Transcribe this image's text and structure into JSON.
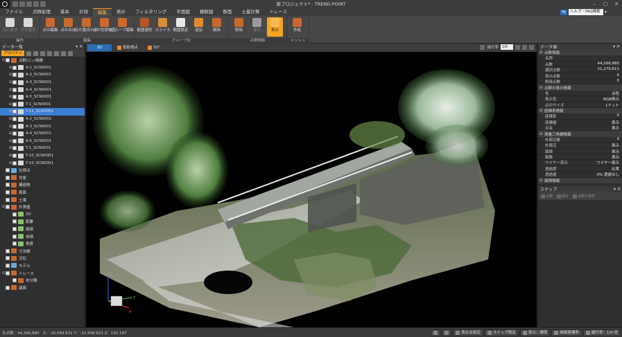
{
  "window": {
    "title": "新プロジェクト* - TREND-POINT",
    "controls": [
      "–",
      "▢",
      "✕"
    ]
  },
  "menu": {
    "tabs": [
      {
        "label": "ファイル",
        "active": false
      },
      {
        "label": "点群処理",
        "active": false
      },
      {
        "label": "基本",
        "active": false
      },
      {
        "label": "計測",
        "active": false
      },
      {
        "label": "編集",
        "active": true
      },
      {
        "label": "表示",
        "active": false
      },
      {
        "label": "フィルタリング",
        "active": false
      },
      {
        "label": "平面図",
        "active": false
      },
      {
        "label": "横断図",
        "active": false
      },
      {
        "label": "断面",
        "active": false
      },
      {
        "label": "土量計算",
        "active": false
      },
      {
        "label": "トレース",
        "active": false
      }
    ],
    "help_badge": "FA",
    "help_label": "ヘルプ・FAQ検索"
  },
  "ribbon": {
    "groups": [
      {
        "title": "操作",
        "buttons": [
          {
            "label": "元に戻す",
            "color": "#d9d9d9",
            "dim": true
          },
          {
            "label": "やり直す",
            "color": "#d9d9d9",
            "dim": true
          }
        ]
      },
      {
        "title": "編集",
        "buttons": [
          {
            "label": "点の編集",
            "color": "#c9692f"
          },
          {
            "label": "点の合成",
            "color": "#c9692f"
          },
          {
            "label": "点の重合わせ",
            "color": "#c9692f"
          },
          {
            "label": "点の色調補正",
            "color": "#c9692f"
          },
          {
            "label": "グループ編集",
            "color": "#c9692f"
          }
        ]
      },
      {
        "title": "グループ化",
        "buttons": [
          {
            "label": "範囲選択",
            "color": "#b8542a"
          },
          {
            "label": "スライス",
            "color": "#d98c3a"
          },
          {
            "label": "範囲設定",
            "color": "#e8e8e8"
          },
          {
            "label": "追加",
            "color": "#e38b2c"
          },
          {
            "label": "解除",
            "color": "#c9692f"
          }
        ]
      },
      {
        "title": "点群削除",
        "buttons": [
          {
            "label": "削除",
            "color": "#c9692f"
          },
          {
            "label": "復元",
            "color": "#999999",
            "dim": true
          },
          {
            "label": "表示",
            "color": "#f7b955",
            "active": true
          }
        ]
      },
      {
        "title": "メッシュ",
        "buttons": [
          {
            "label": "作成",
            "color": "#c9692f"
          }
        ]
      }
    ]
  },
  "tree_panel": {
    "title": "データ一覧",
    "property_tab": "プロパティ",
    "items": [
      {
        "label": "点群/二ッ梅橋",
        "indent": 0,
        "expander": "⊟",
        "icon_color": "#c9692f",
        "checked": true,
        "selected": false
      },
      {
        "label": "A-1_SCN0001",
        "indent": 1,
        "expander": "⊞",
        "icon_color": "#d8d8d8",
        "checked": true,
        "selected": false
      },
      {
        "label": "A-2_SCN0001",
        "indent": 1,
        "expander": "⊞",
        "icon_color": "#d8d8d8",
        "checked": true,
        "selected": false
      },
      {
        "label": "A-3_SCN0001",
        "indent": 1,
        "expander": "⊞",
        "icon_color": "#d8d8d8",
        "checked": true,
        "selected": false
      },
      {
        "label": "A-4_SCN0001",
        "indent": 1,
        "expander": "⊞",
        "icon_color": "#d8d8d8",
        "checked": true,
        "selected": false
      },
      {
        "label": "A-5_SCN0001",
        "indent": 1,
        "expander": "⊞",
        "icon_color": "#d8d8d8",
        "checked": true,
        "selected": false
      },
      {
        "label": "T-1_SCN0001",
        "indent": 1,
        "expander": "⊞",
        "icon_color": "#d8d8d8",
        "checked": true,
        "selected": false
      },
      {
        "label": "T-11_SCN0001",
        "indent": 1,
        "expander": "⊞",
        "icon_color": "#d8d8d8",
        "checked": true,
        "selected": true
      },
      {
        "label": "A-2_SCN0001",
        "indent": 1,
        "expander": "⊞",
        "icon_color": "#d8d8d8",
        "checked": true,
        "selected": false
      },
      {
        "label": "A-3_SCN0001",
        "indent": 1,
        "expander": "⊞",
        "icon_color": "#d8d8d8",
        "checked": true,
        "selected": false
      },
      {
        "label": "A-4_SCN0001",
        "indent": 1,
        "expander": "⊞",
        "icon_color": "#d8d8d8",
        "checked": true,
        "selected": false
      },
      {
        "label": "A-5_SCN0001",
        "indent": 1,
        "expander": "⊞",
        "icon_color": "#d8d8d8",
        "checked": true,
        "selected": false
      },
      {
        "label": "T-1_SCN0001",
        "indent": 1,
        "expander": "⊞",
        "icon_color": "#d8d8d8",
        "checked": true,
        "selected": false
      },
      {
        "label": "T-10_SCN0001",
        "indent": 1,
        "expander": "⊞",
        "icon_color": "#d8d8d8",
        "checked": true,
        "selected": false
      },
      {
        "label": "T-10_SCN0001",
        "indent": 1,
        "expander": "⊞",
        "icon_color": "#d8d8d8",
        "checked": true,
        "selected": false
      },
      {
        "label": "仕様点",
        "indent": 0,
        "expander": "",
        "icon_color": "#6aa9e0",
        "checked": true,
        "selected": false
      },
      {
        "label": "背景",
        "indent": 0,
        "expander": "",
        "icon_color": "#c9692f",
        "checked": true,
        "selected": false
      },
      {
        "label": "構造物",
        "indent": 0,
        "expander": "",
        "icon_color": "#c9692f",
        "checked": true,
        "selected": false
      },
      {
        "label": "路面",
        "indent": 0,
        "expander": "",
        "icon_color": "#c9692f",
        "checked": true,
        "selected": false
      },
      {
        "label": "土壌",
        "indent": 0,
        "expander": "",
        "icon_color": "#c9692f",
        "checked": true,
        "selected": false
      },
      {
        "label": "計測値",
        "indent": 0,
        "expander": "⊟",
        "icon_color": "#c9692f",
        "checked": true,
        "selected": false
      },
      {
        "label": "3D",
        "indent": 1,
        "expander": "",
        "icon_color": "#8fbf6a",
        "checked": true,
        "selected": false
      },
      {
        "label": "距離",
        "indent": 1,
        "expander": "",
        "icon_color": "#8fbf6a",
        "checked": true,
        "selected": false
      },
      {
        "label": "面積",
        "indent": 1,
        "expander": "",
        "icon_color": "#8fbf6a",
        "checked": true,
        "selected": false
      },
      {
        "label": "体積",
        "indent": 1,
        "expander": "",
        "icon_color": "#8fbf6a",
        "checked": true,
        "selected": false
      },
      {
        "label": "角度",
        "indent": 1,
        "expander": "",
        "icon_color": "#8fbf6a",
        "checked": true,
        "selected": false
      },
      {
        "label": "寸法線",
        "indent": 0,
        "expander": "",
        "icon_color": "#c9692f",
        "checked": true,
        "selected": false
      },
      {
        "label": "注記",
        "indent": 0,
        "expander": "",
        "icon_color": "#c9692f",
        "checked": true,
        "selected": false
      },
      {
        "label": "モデル",
        "indent": 0,
        "expander": "",
        "icon_color": "#6aa9e0",
        "checked": true,
        "selected": false
      },
      {
        "label": "トレース",
        "indent": 0,
        "expander": "⊟",
        "icon_color": "#c9692f",
        "checked": true,
        "selected": false
      },
      {
        "label": "未分類",
        "indent": 1,
        "expander": "",
        "icon_color": "#c9692f",
        "checked": true,
        "selected": false
      },
      {
        "label": "図面",
        "indent": 0,
        "expander": "",
        "icon_color": "#c9692f",
        "checked": true,
        "selected": false
      }
    ]
  },
  "viewport": {
    "tabs": [
      {
        "label": "3D",
        "active": true
      },
      {
        "label": "投影視点",
        "active": false
      },
      {
        "label": "30°",
        "active": false
      }
    ],
    "scale_label": "縮尺率",
    "scale_value": "1/0",
    "axis_x": "X",
    "axis_y": "Y",
    "axis_z": "Z"
  },
  "properties": {
    "title": "データ値",
    "sections": [
      {
        "title": "点群情報",
        "rows": [
          {
            "key": "名称",
            "value": ""
          },
          {
            "key": "点数",
            "value": "44,266,880"
          },
          {
            "key": "選択点数",
            "value": "21,279,611"
          },
          {
            "key": "表示点数",
            "value": "0"
          },
          {
            "key": "削除点数",
            "value": "0"
          }
        ]
      },
      {
        "title": "点群の表示情報",
        "rows": [
          {
            "key": "色",
            "value": "点色"
          },
          {
            "key": "表示色",
            "value": "RGB表示"
          },
          {
            "key": "点のサイズ",
            "value": "1ドット"
          }
        ]
      },
      {
        "title": "座標系情報",
        "rows": [
          {
            "key": "座標系",
            "value": "0"
          },
          {
            "key": "座標値",
            "value": "表示"
          },
          {
            "key": "点名",
            "value": "表示"
          }
        ]
      },
      {
        "title": "測量三角網情報",
        "rows": [
          {
            "key": "外周辺数",
            "value": "0"
          },
          {
            "key": "外周辺",
            "value": "表示"
          },
          {
            "key": "面積",
            "value": "表示"
          },
          {
            "key": "面数",
            "value": "表示"
          },
          {
            "key": "ワイヤー表示",
            "value": "ワイヤー表示"
          },
          {
            "key": "透過度",
            "value": "比率"
          },
          {
            "key": "透過値",
            "value": "0% 透過なし"
          }
        ]
      },
      {
        "title": "面積情報",
        "rows": []
      }
    ]
  },
  "snap_panel": {
    "title": "スナップ",
    "tools": [
      "点群",
      "線分",
      "点群の選択"
    ]
  },
  "status": {
    "left": "全点数：44,266,880　X：-16,599.631 Y：-32,508.821 Z：155.187",
    "buttons": [
      {
        "label": "",
        "icon": true
      },
      {
        "label": "",
        "icon": true
      },
      {
        "label": "表示点設定"
      },
      {
        "label": "スナップ設定"
      },
      {
        "label": "表示：標準"
      },
      {
        "label": "画面座標系"
      },
      {
        "label": "縮尺率：1/0 倍"
      }
    ]
  }
}
